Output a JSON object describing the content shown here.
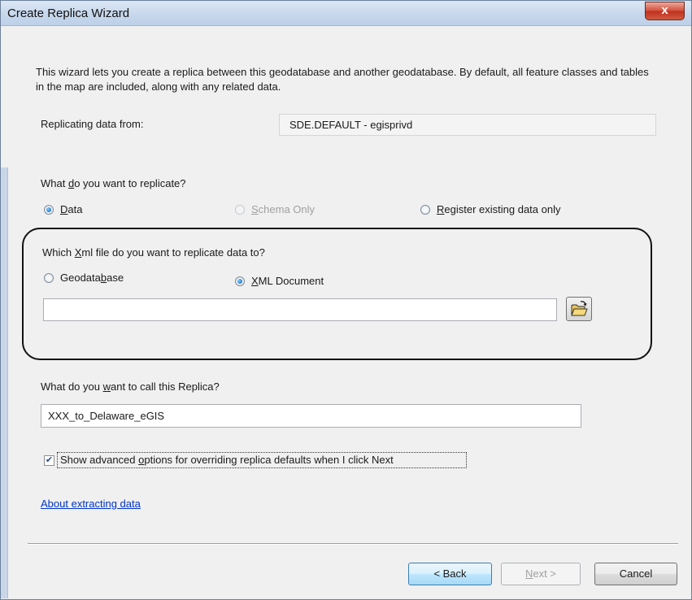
{
  "window": {
    "title": "Create Replica Wizard",
    "close_glyph": "x"
  },
  "intro": "This wizard lets you create a replica between this geodatabase  and another geodatabase. By default, all feature classes and tables in the map are included, along with any related data.",
  "replicating_from": {
    "label": "Replicating data from:",
    "value": "SDE.DEFAULT - egisprivd"
  },
  "replicate_what": {
    "question_pre": "What ",
    "question_key": "d",
    "question_post": "o you want to replicate?",
    "options": [
      {
        "key": "D",
        "rest": "ata",
        "selected": true,
        "enabled": true
      },
      {
        "key": "S",
        "rest": "chema Only",
        "selected": false,
        "enabled": false
      },
      {
        "key": "R",
        "rest": "egister existing data only",
        "selected": false,
        "enabled": true
      }
    ]
  },
  "target": {
    "question_pre": "Which ",
    "question_key": "X",
    "question_post": "ml file do you want to replicate data to?",
    "geodatabase": {
      "pre": "Geodata",
      "key": "b",
      "post": "ase",
      "selected": false
    },
    "xml": {
      "pre": "",
      "key": "X",
      "post": "ML Document",
      "selected": true
    },
    "path_value": "",
    "browse_icon": "open-folder-icon"
  },
  "replica_name": {
    "label_pre": "What do you ",
    "label_key": "w",
    "label_post": "ant to call this Replica?",
    "value": "XXX_to_Delaware_eGIS"
  },
  "advanced": {
    "pre": "Show advanced ",
    "key": "o",
    "post": "ptions for overriding replica defaults when I click Next",
    "checked": true
  },
  "about_link": "About extracting data",
  "buttons": {
    "back": "< Back",
    "next": "Next >",
    "cancel": "Cancel"
  },
  "colors": {
    "link": "#0033cc",
    "titlebar": "#c9d9ec",
    "close": "#c0321f"
  }
}
